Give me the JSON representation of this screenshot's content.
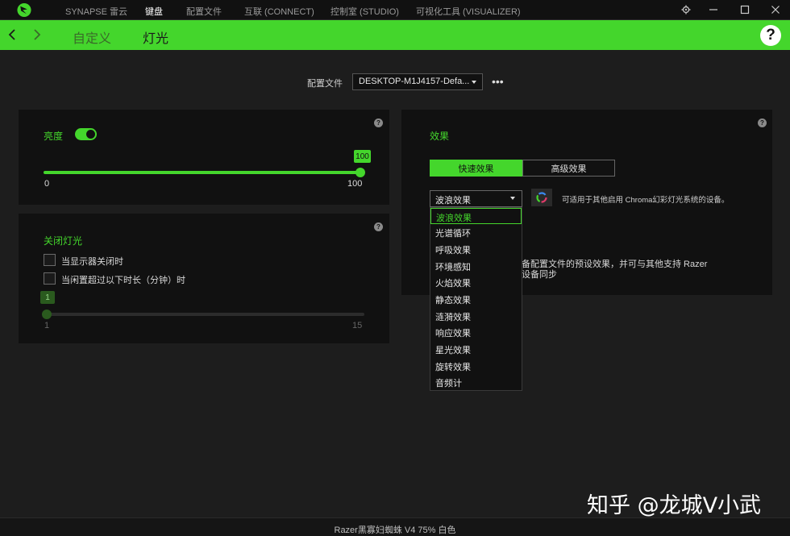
{
  "titlebar": {
    "tabs": [
      "SYNAPSE 雷云",
      "键盘",
      "配置文件",
      "互联 (CONNECT)",
      "控制室 (STUDIO)",
      "可视化工具 (VISUALIZER)"
    ],
    "active_tab": 1
  },
  "header": {
    "crumbs": [
      "自定义",
      "灯光"
    ],
    "help_glyph": "?"
  },
  "profile": {
    "label": "配置文件",
    "value": "DESKTOP-M1J4157-Defa...",
    "more": "•••"
  },
  "brightness": {
    "label": "亮度",
    "enabled": true,
    "value": "100",
    "min": "0",
    "max": "100"
  },
  "lights_off": {
    "label": "关闭灯光",
    "options": [
      "当显示器关闭时",
      "当闲置超过以下时长（分钟）时"
    ],
    "slider_value": "1",
    "min": "1",
    "max": "15"
  },
  "effects": {
    "label": "效果",
    "tabs": [
      "快速效果",
      "高级效果"
    ],
    "active_tab": 0,
    "selected": "波浪效果",
    "chroma_note": "可适用于其他启用 Chroma幻彩灯光系统的设备。",
    "description_lines": [
      "备配置文件的预设效果，并可与其他支持 Razer",
      "设备同步"
    ],
    "options": [
      "波浪效果",
      "光谱循环",
      "呼吸效果",
      "环境感知",
      "火焰效果",
      "静态效果",
      "涟漪效果",
      "响应效果",
      "星光效果",
      "旋转效果",
      "音频计"
    ]
  },
  "watermark": "知乎 @龙城V小武",
  "footer": "Razer黑寡妇蜘蛛 V4 75% 白色",
  "colors": {
    "accent": "#44d62c",
    "background": "#1d1d1d",
    "panel": "#111111"
  },
  "icons": [
    "razer-logo-icon",
    "settings-gear-icon",
    "minimize-icon",
    "maximize-icon",
    "close-icon",
    "back-arrow-icon",
    "forward-arrow-icon",
    "help-icon",
    "chroma-icon"
  ]
}
